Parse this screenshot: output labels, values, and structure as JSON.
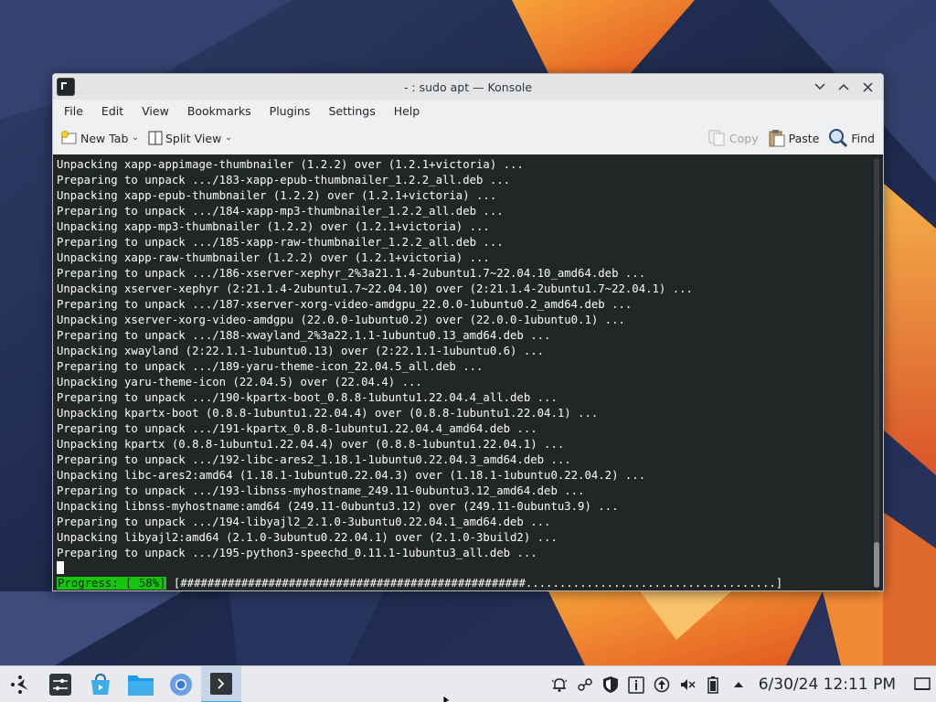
{
  "window": {
    "title": "- : sudo apt — Konsole"
  },
  "menu": [
    "File",
    "Edit",
    "View",
    "Bookmarks",
    "Plugins",
    "Settings",
    "Help"
  ],
  "toolbar": {
    "new_tab": "New Tab",
    "split_view": "Split View",
    "copy": "Copy",
    "paste": "Paste",
    "find": "Find"
  },
  "terminal": {
    "lines": [
      "Unpacking xapp-appimage-thumbnailer (1.2.2) over (1.2.1+victoria) ...",
      "Preparing to unpack .../183-xapp-epub-thumbnailer_1.2.2_all.deb ...",
      "Unpacking xapp-epub-thumbnailer (1.2.2) over (1.2.1+victoria) ...",
      "Preparing to unpack .../184-xapp-mp3-thumbnailer_1.2.2_all.deb ...",
      "Unpacking xapp-mp3-thumbnailer (1.2.2) over (1.2.1+victoria) ...",
      "Preparing to unpack .../185-xapp-raw-thumbnailer_1.2.2_all.deb ...",
      "Unpacking xapp-raw-thumbnailer (1.2.2) over (1.2.1+victoria) ...",
      "Preparing to unpack .../186-xserver-xephyr_2%3a21.1.4-2ubuntu1.7~22.04.10_amd64.deb ...",
      "Unpacking xserver-xephyr (2:21.1.4-2ubuntu1.7~22.04.10) over (2:21.1.4-2ubuntu1.7~22.04.1) ...",
      "Preparing to unpack .../187-xserver-xorg-video-amdgpu_22.0.0-1ubuntu0.2_amd64.deb ...",
      "Unpacking xserver-xorg-video-amdgpu (22.0.0-1ubuntu0.2) over (22.0.0-1ubuntu0.1) ...",
      "Preparing to unpack .../188-xwayland_2%3a22.1.1-1ubuntu0.13_amd64.deb ...",
      "Unpacking xwayland (2:22.1.1-1ubuntu0.13) over (2:22.1.1-1ubuntu0.6) ...",
      "Preparing to unpack .../189-yaru-theme-icon_22.04.5_all.deb ...",
      "Unpacking yaru-theme-icon (22.04.5) over (22.04.4) ...",
      "Preparing to unpack .../190-kpartx-boot_0.8.8-1ubuntu1.22.04.4_all.deb ...",
      "Unpacking kpartx-boot (0.8.8-1ubuntu1.22.04.4) over (0.8.8-1ubuntu1.22.04.1) ...",
      "Preparing to unpack .../191-kpartx_0.8.8-1ubuntu1.22.04.4_amd64.deb ...",
      "Unpacking kpartx (0.8.8-1ubuntu1.22.04.4) over (0.8.8-1ubuntu1.22.04.1) ...",
      "Preparing to unpack .../192-libc-ares2_1.18.1-1ubuntu0.22.04.3_amd64.deb ...",
      "Unpacking libc-ares2:amd64 (1.18.1-1ubuntu0.22.04.3) over (1.18.1-1ubuntu0.22.04.2) ...",
      "Preparing to unpack .../193-libnss-myhostname_249.11-0ubuntu3.12_amd64.deb ...",
      "Unpacking libnss-myhostname:amd64 (249.11-0ubuntu3.12) over (249.11-0ubuntu3.9) ...",
      "Preparing to unpack .../194-libyajl2_2.1.0-3ubuntu0.22.04.1_amd64.deb ...",
      "Unpacking libyajl2:amd64 (2.1.0-3ubuntu0.22.04.1) over (2.1.0-3build2) ...",
      "Preparing to unpack .../195-python3-speechd_0.11.1-1ubuntu3_all.deb ..."
    ],
    "progress_label": "Progress: [ 58%]",
    "progress_bar": " [###################################################.....................................]",
    "progress_percent": 58
  },
  "taskbar": {
    "apps": [
      "application-launcher-icon",
      "settings-icon",
      "discover-store-icon",
      "file-manager-icon",
      "chromium-browser-icon",
      "konsole-icon"
    ],
    "clock": "6/30/24 12:11 PM"
  },
  "colors": {
    "terminal_bg": "#232627",
    "terminal_fg": "#fcfcfc",
    "progress_green": "#16c60c",
    "accent": "#3daee9"
  }
}
